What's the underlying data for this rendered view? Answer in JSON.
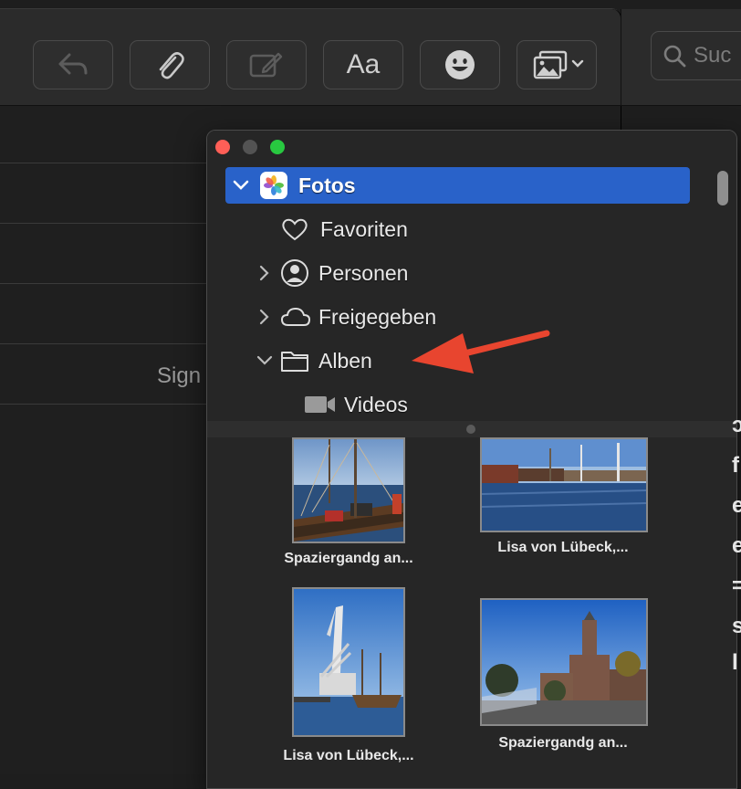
{
  "toolbar": {
    "buttons": [
      {
        "name": "reply-icon"
      },
      {
        "name": "paperclip-icon"
      },
      {
        "name": "markup-icon"
      },
      {
        "name": "format-button",
        "label": "Aa"
      },
      {
        "name": "emoji-icon"
      },
      {
        "name": "photo-browser-icon"
      }
    ],
    "search_placeholder": "Suc"
  },
  "mail": {
    "signature_label": "Sign"
  },
  "photo_browser": {
    "root": {
      "label": "Fotos",
      "icon": "photos-app-icon"
    },
    "items": [
      {
        "label": "Favoriten",
        "icon": "heart-icon",
        "disclosure": "none"
      },
      {
        "label": "Personen",
        "icon": "person-icon",
        "disclosure": "collapsed"
      },
      {
        "label": "Freigegeben",
        "icon": "cloud-icon",
        "disclosure": "collapsed"
      },
      {
        "label": "Alben",
        "icon": "folder-icon",
        "disclosure": "expanded"
      },
      {
        "label": "Videos",
        "icon": "video-camera-icon",
        "disclosure": "none"
      }
    ],
    "photos": [
      {
        "caption": "Spaziergandg an..."
      },
      {
        "caption": "Lisa von Lübeck,..."
      },
      {
        "caption": "Lisa von Lübeck,..."
      },
      {
        "caption": "Spaziergandg an..."
      }
    ]
  },
  "colors": {
    "selection": "#2962c9",
    "annotation_arrow": "#e8452f",
    "close": "#ff5f57",
    "zoom": "#28c840"
  }
}
